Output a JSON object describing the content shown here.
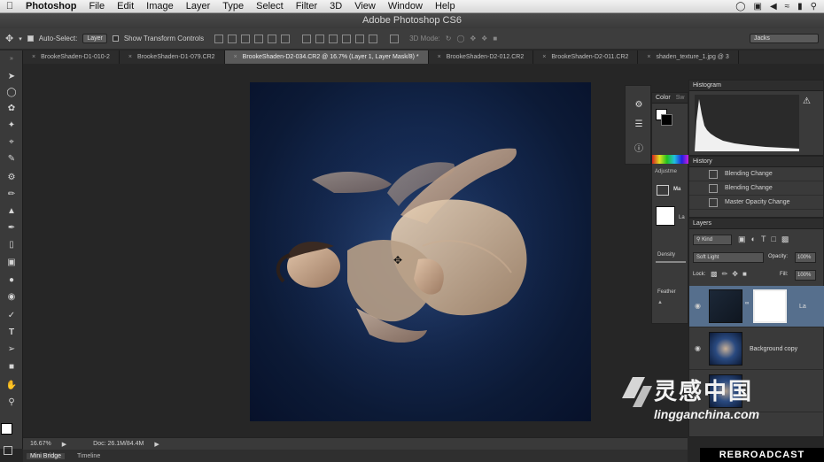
{
  "menubar": {
    "items": [
      "Photoshop",
      "File",
      "Edit",
      "Image",
      "Layer",
      "Type",
      "Select",
      "Filter",
      "3D",
      "View",
      "Window",
      "Help"
    ]
  },
  "window": {
    "title": "Adobe Photoshop CS6"
  },
  "options": {
    "auto_select_label": "Auto-Select:",
    "auto_select_value": "Layer",
    "show_transform_label": "Show Transform Controls",
    "mode_label": "3D Mode:",
    "workspace": "Jacks"
  },
  "tabs": [
    "BrookeShaden-D1-010-2",
    "BrookeShaden-D1-079.CR2",
    "BrookeShaden-D2-034.CR2 @ 16.7% (Layer 1, Layer Mask/8) *",
    "BrookeShaden-D2-012.CR2",
    "BrookeShaden-D2-011.CR2",
    "shaden_texture_1.jpg @ 3"
  ],
  "status": {
    "zoom": "16.67%",
    "doc": "Doc: 26.1M/84.4M"
  },
  "bottom_tabs": [
    "Mini Bridge",
    "Timeline"
  ],
  "panels": {
    "color_title": "Color",
    "color_tab2": "Sw",
    "adjustments_title": "Adjustme",
    "mask_label": "Ma",
    "layer_label": "La",
    "density_label": "Density",
    "feather_label": "Feather",
    "histogram_title": "Histogram",
    "history_title": "History",
    "history_items": [
      "Blending Change",
      "Blending Change",
      "Master Opacity Change"
    ],
    "layers_title": "Layers",
    "kind_label": "Kind",
    "blend_mode": "Soft Light",
    "opacity_label": "Opacity:",
    "opacity_value": "100%",
    "lock_label": "Lock:",
    "fill_label": "Fill:",
    "fill_value": "100%",
    "layer_rows": [
      "La",
      "Background copy"
    ]
  },
  "watermark": {
    "cn": "灵感中国",
    "en": "lingganchina.com",
    "rebroadcast": "REBROADCAST"
  }
}
